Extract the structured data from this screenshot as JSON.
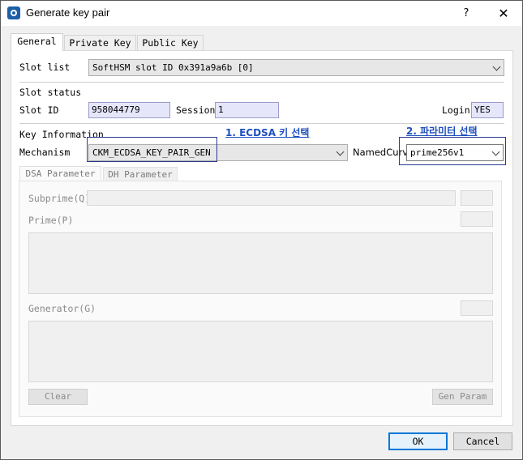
{
  "window": {
    "title": "Generate key pair",
    "help_glyph": "?",
    "close_glyph": "✕"
  },
  "tabs": [
    {
      "label": "General",
      "active": true
    },
    {
      "label": "Private Key",
      "active": false
    },
    {
      "label": "Public Key",
      "active": false
    }
  ],
  "slot_list": {
    "label": "Slot list",
    "value": "SoftHSM slot ID 0x391a9a6b [0]"
  },
  "slot_status": {
    "heading": "Slot status",
    "slot_id_label": "Slot ID",
    "slot_id_value": "958044779",
    "session_label": "Session",
    "session_value": "1",
    "login_label": "Login",
    "login_value": "YES"
  },
  "key_info": {
    "heading": "Key Information",
    "mechanism_label": "Mechanism",
    "mechanism_value": "CKM_ECDSA_KEY_PAIR_GEN",
    "named_curve_label": "NamedCurve",
    "named_curve_value": "prime256v1"
  },
  "annotations": {
    "step1": "1. ECDSA 키 선택",
    "step2": "2. 파라미터 선택",
    "color": "#1f4fbf"
  },
  "sub_tabs": [
    {
      "label": "DSA Parameter",
      "active": true
    },
    {
      "label": "DH Parameter",
      "active": false
    }
  ],
  "dsa": {
    "subprime_label": "Subprime(Q)",
    "prime_label": "Prime(P)",
    "generator_label": "Generator(G)",
    "clear_label": "Clear",
    "gen_param_label": "Gen Param"
  },
  "footer": {
    "ok_label": "OK",
    "cancel_label": "Cancel"
  }
}
